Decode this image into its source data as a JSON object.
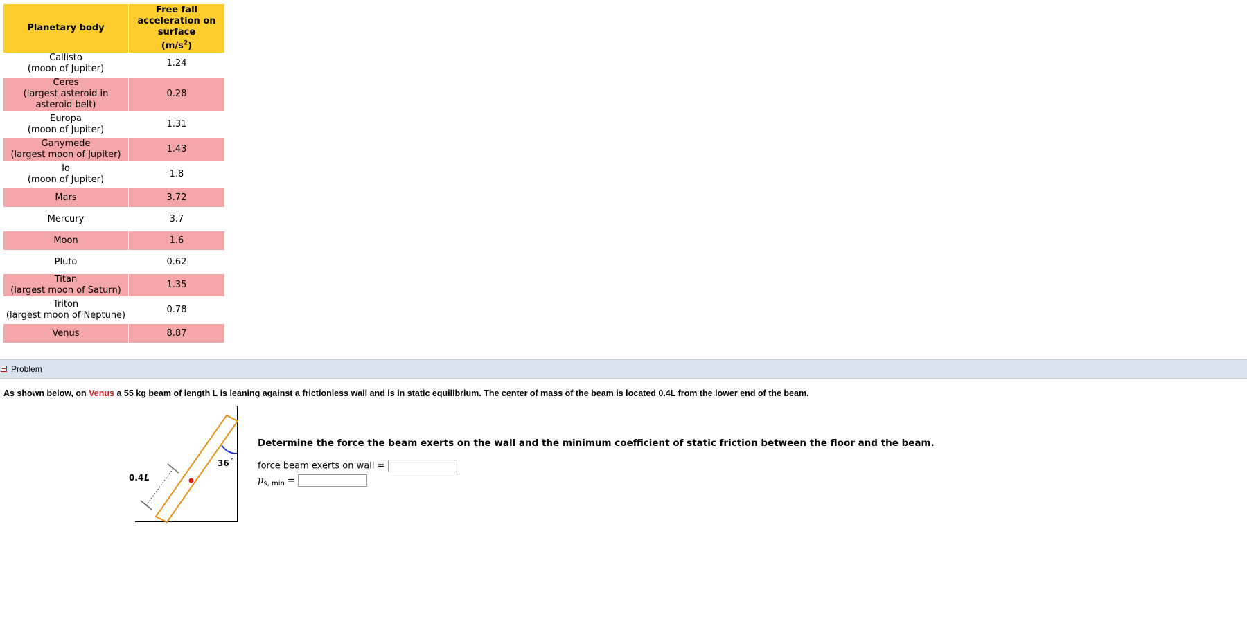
{
  "table": {
    "header_col1": "Planetary body",
    "header_col2_lines": [
      "Free fall",
      "acceleration on",
      "surface"
    ],
    "header_unit": "(m/s",
    "header_unit_sup": "2",
    "header_unit_close": ")",
    "rows": [
      {
        "name": "Callisto",
        "sub": "(moon of Jupiter)",
        "value": "1.24"
      },
      {
        "name": "Ceres",
        "sub": "(largest asteroid in",
        "sub2": "asteroid belt)",
        "value": "0.28"
      },
      {
        "name": "Europa",
        "sub": "(moon of Jupiter)",
        "value": "1.31"
      },
      {
        "name": "Ganymede",
        "sub": "(largest moon of Jupiter)",
        "value": "1.43"
      },
      {
        "name": "Io",
        "sub": "(moon of Jupiter)",
        "value": "1.8"
      },
      {
        "name": "Mars",
        "value": "3.72"
      },
      {
        "name": "Mercury",
        "value": "3.7"
      },
      {
        "name": "Moon",
        "value": "1.6"
      },
      {
        "name": "Pluto",
        "value": "0.62"
      },
      {
        "name": "Titan",
        "sub": "(largest moon of Saturn)",
        "value": "1.35"
      },
      {
        "name": "Triton",
        "sub": "(largest moon of Neptune)",
        "value": "0.78"
      },
      {
        "name": "Venus",
        "value": "8.87"
      }
    ]
  },
  "problem": {
    "section_title": "Problem",
    "statement_prefix": "As shown below, on ",
    "statement_planet": "Venus",
    "statement_suffix": " a 55 kg beam of length L is leaning against a frictionless wall and is in static equilibrium. The center of mass of the beam is located 0.4L from the lower end of the beam.",
    "diagram": {
      "angle_label": "36",
      "degree": "°",
      "length_label": "0.4",
      "length_var": "L"
    },
    "question": "Determine the force the beam exerts on the wall and the minimum coefficient of static friction between the floor and the beam.",
    "answer1_label": "force beam exerts on wall =",
    "answer1_value": "",
    "answer2_mu": "μ",
    "answer2_sub": "s, min",
    "answer2_eq": " =",
    "answer2_value": ""
  },
  "colors": {
    "header_bg": "#fdcc2d",
    "pink_row": "#f4a6a8",
    "problem_bar": "#d9e4ee",
    "planet_red": "#d21a1a",
    "beam_orange": "#e8901a",
    "angle_blue": "#1a2ed2",
    "com_red": "#e01818"
  }
}
